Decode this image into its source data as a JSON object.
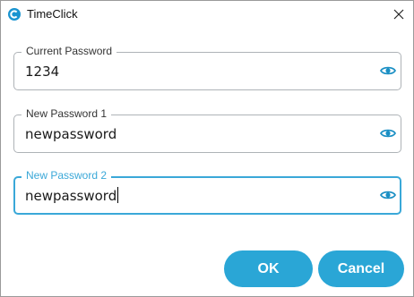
{
  "window": {
    "title": "TimeClick",
    "accent_color": "#2aa6d6",
    "icons": {
      "app": "app-logo-icon",
      "close": "close-icon"
    }
  },
  "fields": [
    {
      "label": "Current Password",
      "value": "1234",
      "focused": false,
      "icon": "eye-icon"
    },
    {
      "label": "New Password 1",
      "value": "newpassword",
      "focused": false,
      "icon": "eye-icon"
    },
    {
      "label": "New Password 2",
      "value": "newpassword",
      "focused": true,
      "icon": "eye-icon"
    }
  ],
  "buttons": {
    "ok_label": "OK",
    "cancel_label": "Cancel"
  }
}
